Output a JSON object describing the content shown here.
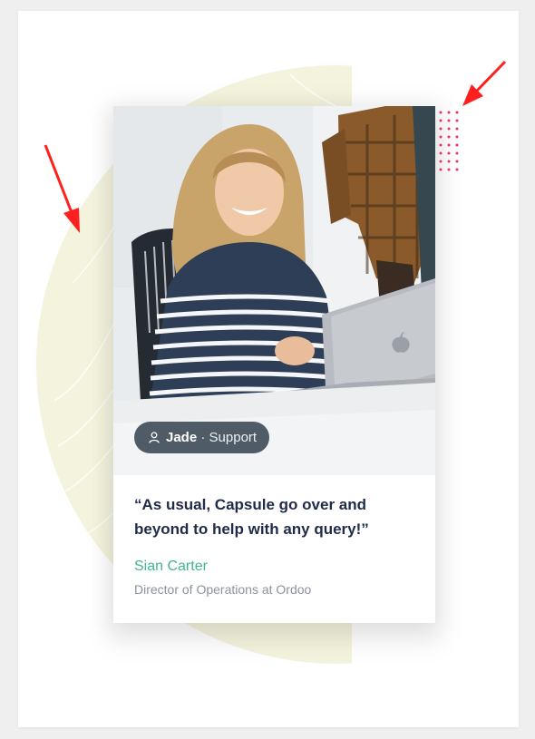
{
  "testimonial": {
    "badge": {
      "name": "Jade",
      "separator": " · ",
      "role": "Support"
    },
    "quote": "“As usual, Capsule go over and beyond to help with any query!”",
    "author": "Sian Carter",
    "author_title": "Director of Operations at Ordoo"
  },
  "colors": {
    "accent_green": "#3fb594",
    "quote_text": "#1f2b48",
    "badge_bg": "#4f5b66",
    "decor_circle": "#f4f4de",
    "dots": "#e8356c",
    "annotation_arrow": "#ff1f1f"
  },
  "icons": {
    "badge_icon": "person-icon"
  }
}
